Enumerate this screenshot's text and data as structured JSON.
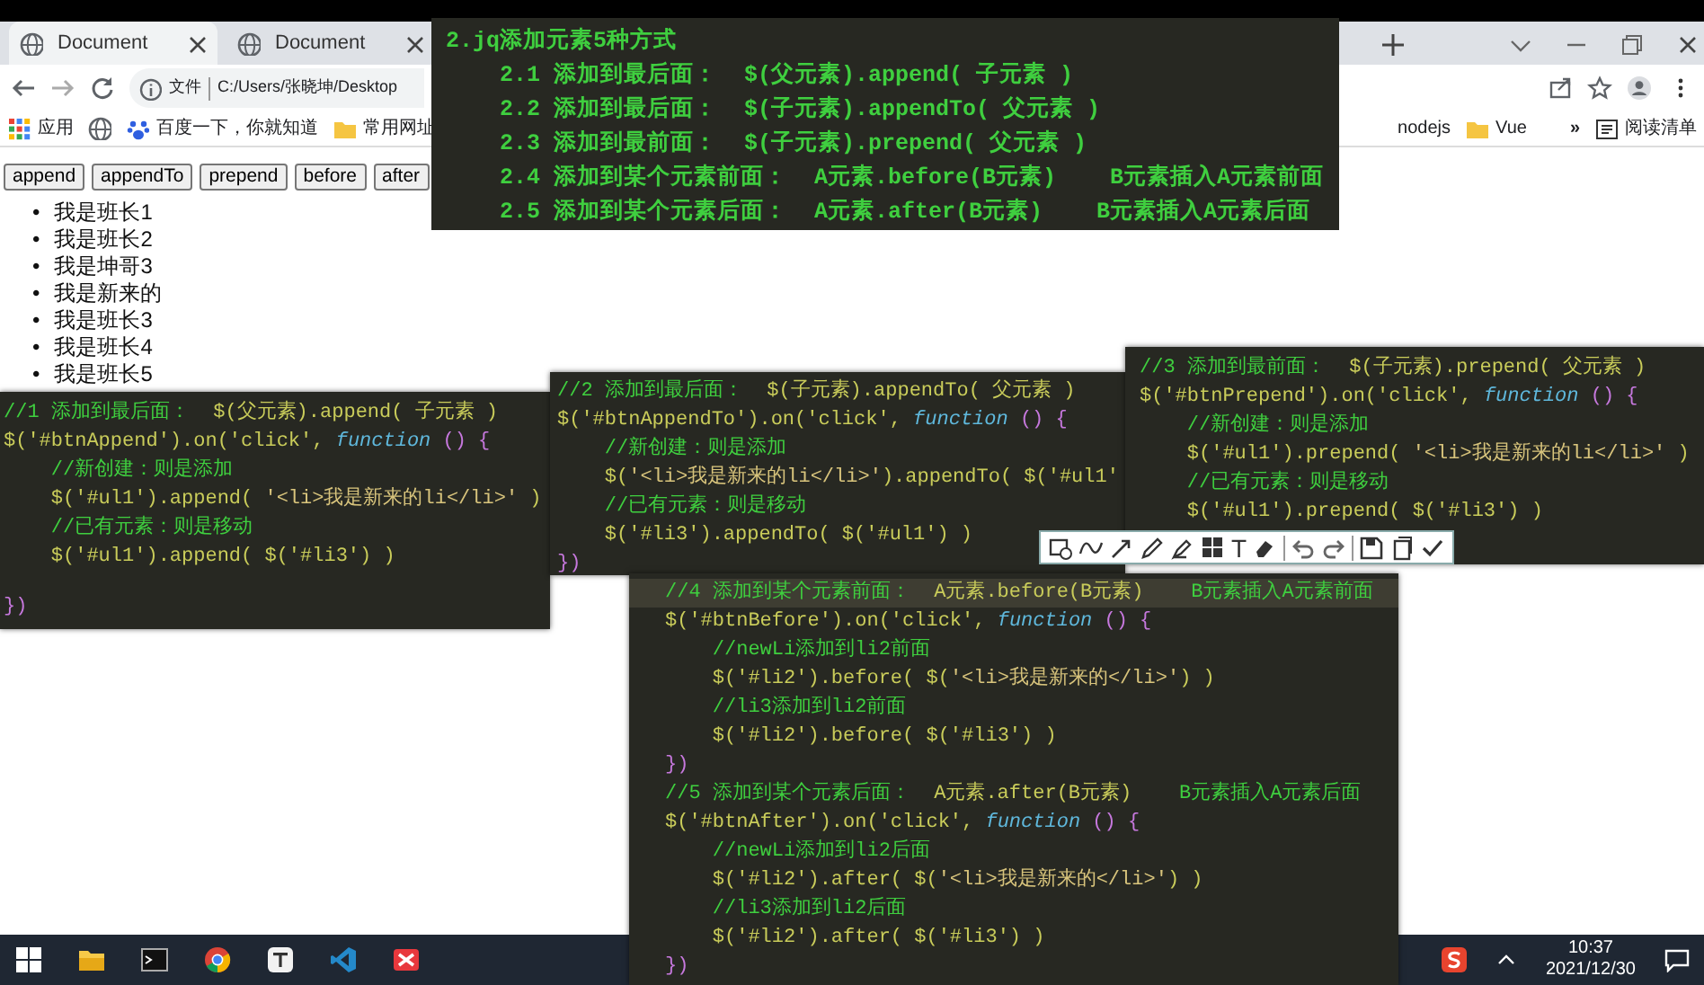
{
  "browser": {
    "tabs": [
      {
        "title": "Document",
        "selected": true
      },
      {
        "title": "Document",
        "selected": false
      }
    ],
    "address": {
      "info": "文件",
      "url": "C:/Users/张晓坤/Desktop"
    },
    "bookmarks": [
      {
        "kind": "apps",
        "label": "应用"
      },
      {
        "kind": "globe"
      },
      {
        "kind": "paw",
        "label": "百度一下，你就知道"
      },
      {
        "kind": "folder",
        "label": "常用网址"
      }
    ],
    "bookmarks_right": [
      {
        "kind": "plain",
        "label": "nodejs"
      },
      {
        "kind": "folder",
        "label": "Vue"
      }
    ],
    "overflow": "»",
    "reading_list": "阅读清单"
  },
  "page": {
    "bullet": "•",
    "buttons": [
      "append",
      "appendTo",
      "prepend",
      "before",
      "after"
    ],
    "list": [
      "我是班长1",
      "我是班长2",
      "我是坤哥3",
      "我是新来的",
      "我是班长3",
      "我是班长4",
      "我是班长5"
    ]
  },
  "notes": {
    "title": "2.jq添加元素5种方式",
    "lines": [
      "2.1 添加到最后面：  $(父元素).append( 子元素 )",
      "2.2 添加到最后面：  $(子元素).appendTo( 父元素 )",
      "2.3 添加到最前面：  $(子元素).prepend( 父元素 )",
      "2.4 添加到某个元素前面：  A元素.before(B元素)    B元素插入A元素前面",
      "2.5 添加到某个元素后面：  A元素.after(B元素)    B元素插入A元素后面"
    ]
  },
  "panels": [
    {
      "lines": [
        {
          "tokens": [
            {
              "kind": "comment",
              "text": "//1 添加到最后面：  "
            },
            {
              "kind": "code",
              "text": "$(父元素).append( 子元素 )"
            }
          ]
        },
        {
          "tokens": [
            {
              "kind": "code",
              "text": "$('#btnAppend').on('click', "
            },
            {
              "kind": "keyword",
              "text": "function"
            },
            {
              "kind": "brace",
              "text": " () {"
            }
          ]
        },
        {
          "tokens": [
            {
              "kind": "comment",
              "text": "    //新创建：则是添加"
            }
          ]
        },
        {
          "tokens": [
            {
              "kind": "code",
              "text": "    $('#ul1').append( "
            },
            {
              "kind": "string",
              "text": "'<li>我是新来的li</li>'"
            },
            {
              "kind": "code",
              "text": " )"
            }
          ]
        },
        {
          "tokens": [
            {
              "kind": "comment",
              "text": "    //已有元素：则是移动"
            }
          ]
        },
        {
          "tokens": [
            {
              "kind": "code",
              "text": "    $('#ul1').append( $('#li3') )"
            }
          ]
        },
        {
          "tokens": [
            {
              "kind": "brace",
              "text": "})"
            }
          ]
        }
      ]
    },
    {
      "lines": [
        {
          "tokens": [
            {
              "kind": "comment",
              "text": "//2 添加到最后面：  "
            },
            {
              "kind": "code",
              "text": "$(子元素).appendTo( 父元素 )"
            }
          ]
        },
        {
          "tokens": [
            {
              "kind": "code",
              "text": "$('#btnAppendTo').on('click', "
            },
            {
              "kind": "keyword",
              "text": "function"
            },
            {
              "kind": "brace",
              "text": " () {"
            }
          ]
        },
        {
          "tokens": [
            {
              "kind": "comment",
              "text": "    //新创建：则是添加"
            }
          ]
        },
        {
          "tokens": [
            {
              "kind": "code",
              "text": "    $("
            },
            {
              "kind": "string",
              "text": "'<li>我是新来的li</li>'"
            },
            {
              "kind": "code",
              "text": ").appendTo( $('#ul1'"
            }
          ]
        },
        {
          "tokens": [
            {
              "kind": "comment",
              "text": "    //已有元素：则是移动"
            }
          ]
        },
        {
          "tokens": [
            {
              "kind": "code",
              "text": "    $('#li3').appendTo( $('#ul1') )"
            }
          ]
        },
        {
          "tokens": [
            {
              "kind": "brace",
              "text": "})"
            }
          ]
        }
      ]
    },
    {
      "lines": [
        {
          "tokens": [
            {
              "kind": "comment",
              "text": "//3 添加到最前面：  "
            },
            {
              "kind": "code",
              "text": "$(子元素).prepend( 父元素 )"
            }
          ]
        },
        {
          "tokens": [
            {
              "kind": "code",
              "text": "$('#btnPrepend').on('click', "
            },
            {
              "kind": "keyword",
              "text": "function"
            },
            {
              "kind": "brace",
              "text": " () {"
            }
          ]
        },
        {
          "tokens": [
            {
              "kind": "comment",
              "text": "    //新创建：则是添加"
            }
          ]
        },
        {
          "tokens": [
            {
              "kind": "code",
              "text": "    $('#ul1').prepend( "
            },
            {
              "kind": "string",
              "text": "'<li>我是新来的li</li>'"
            },
            {
              "kind": "code",
              "text": " )"
            }
          ]
        },
        {
          "tokens": [
            {
              "kind": "comment",
              "text": "    //已有元素：则是移动"
            }
          ]
        },
        {
          "tokens": [
            {
              "kind": "code",
              "text": "    $('#ul1').prepend( $('#li3') )"
            }
          ]
        }
      ]
    },
    {
      "lines": [
        {
          "current": true,
          "tokens": [
            {
              "kind": "comment",
              "text": "//4 添加到某个元素前面：  "
            },
            {
              "kind": "code",
              "text": "A元素.before(B元素)"
            },
            {
              "kind": "comment",
              "text": "    B元素插入A元素前面"
            }
          ]
        },
        {
          "current": false,
          "tokens": [
            {
              "kind": "code",
              "text": "$('#btnBefore').on('click', "
            },
            {
              "kind": "keyword",
              "text": "function"
            },
            {
              "kind": "brace",
              "text": " () {"
            }
          ]
        },
        {
          "current": false,
          "tokens": [
            {
              "kind": "comment",
              "text": "    //newLi添加到li2前面"
            }
          ]
        },
        {
          "current": false,
          "tokens": [
            {
              "kind": "code",
              "text": "    $('#li2').before( $("
            },
            {
              "kind": "string",
              "text": "'<li>我是新来的</li>'"
            },
            {
              "kind": "code",
              "text": ") )"
            }
          ]
        },
        {
          "current": false,
          "tokens": [
            {
              "kind": "comment",
              "text": "    //li3添加到li2前面"
            }
          ]
        },
        {
          "current": false,
          "tokens": [
            {
              "kind": "code",
              "text": "    $('#li2').before( $('#li3') )"
            }
          ]
        },
        {
          "current": false,
          "tokens": [
            {
              "kind": "brace",
              "text": "})"
            }
          ]
        },
        {
          "current": false,
          "tokens": [
            {
              "kind": "comment",
              "text": "//5 添加到某个元素后面：  "
            },
            {
              "kind": "code",
              "text": "A元素.after(B元素)"
            },
            {
              "kind": "comment",
              "text": "    B元素插入A元素后面"
            }
          ]
        },
        {
          "current": false,
          "tokens": [
            {
              "kind": "code",
              "text": "$('#btnAfter').on('click', "
            },
            {
              "kind": "keyword",
              "text": "function"
            },
            {
              "kind": "brace",
              "text": " () {"
            }
          ]
        },
        {
          "current": false,
          "tokens": [
            {
              "kind": "comment",
              "text": "    //newLi添加到li2后面"
            }
          ]
        },
        {
          "current": false,
          "tokens": [
            {
              "kind": "code",
              "text": "    $('#li2').after( $("
            },
            {
              "kind": "string",
              "text": "'<li>我是新来的</li>'"
            },
            {
              "kind": "code",
              "text": ") )"
            }
          ]
        },
        {
          "current": false,
          "tokens": [
            {
              "kind": "comment",
              "text": "    //li3添加到li2后面"
            }
          ]
        },
        {
          "current": false,
          "tokens": [
            {
              "kind": "code",
              "text": "    $('#li2').after( $('#li3') )"
            }
          ]
        },
        {
          "current": false,
          "tokens": [
            {
              "kind": "brace",
              "text": "})"
            }
          ]
        }
      ]
    }
  ],
  "toolbar": [
    {
      "kind": "rect"
    },
    {
      "kind": "curve"
    },
    {
      "kind": "arrow"
    },
    {
      "kind": "pencil"
    },
    {
      "kind": "marker"
    },
    {
      "kind": "mosaic"
    },
    {
      "kind": "text",
      "label": "T"
    },
    {
      "kind": "eraser"
    },
    {
      "kind": "divider"
    },
    {
      "kind": "undo"
    },
    {
      "kind": "redo"
    },
    {
      "kind": "divider"
    },
    {
      "kind": "save"
    },
    {
      "kind": "copy"
    },
    {
      "kind": "check"
    }
  ],
  "taskbar": {
    "apps": [
      {
        "kind": "start"
      },
      {
        "kind": "folder"
      },
      {
        "kind": "terminal"
      },
      {
        "kind": "chrome"
      },
      {
        "kind": "typora"
      },
      {
        "kind": "vscode"
      },
      {
        "kind": "xmind"
      }
    ],
    "time": "10:37",
    "date": "2021/12/30"
  }
}
